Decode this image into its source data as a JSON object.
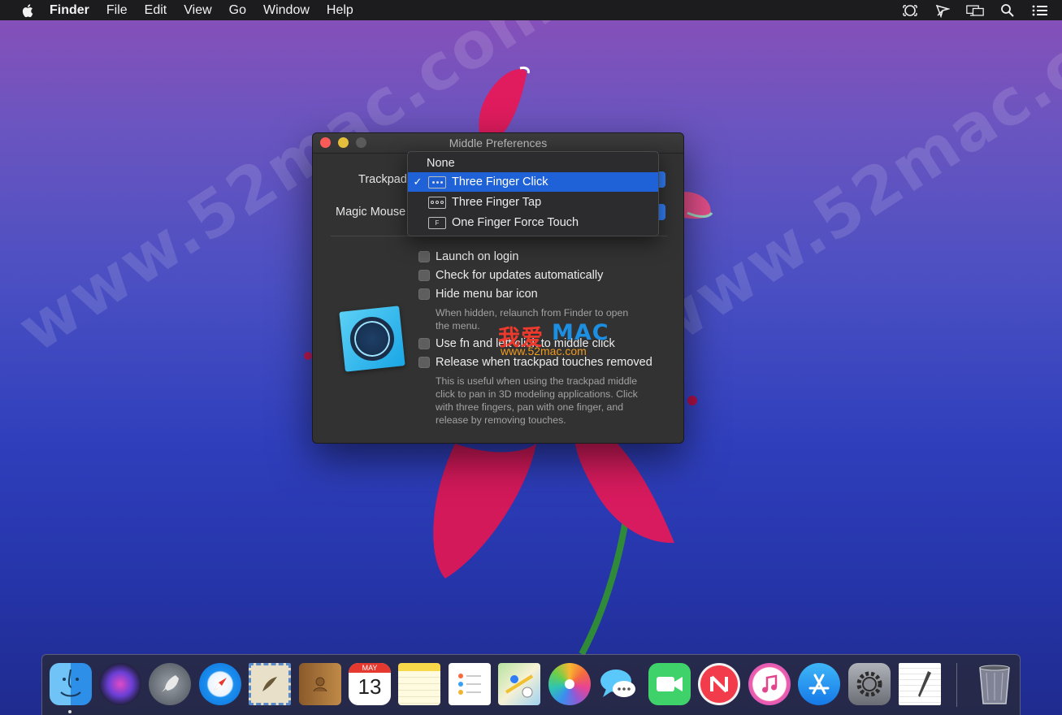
{
  "menubar": {
    "app_name": "Finder",
    "menus": [
      "File",
      "Edit",
      "View",
      "Go",
      "Window",
      "Help"
    ],
    "status_icons": [
      "screen-capture-icon",
      "middle-cursor-icon",
      "airplay-display-icon",
      "spotlight-search-icon",
      "notification-center-icon"
    ]
  },
  "desktop": {
    "watermark_text": "www.52mac.com"
  },
  "window": {
    "title": "Middle Preferences",
    "trackpad_label": "Trackpad",
    "magic_mouse_label": "Magic Mouse",
    "options": [
      {
        "label": "Launch on login",
        "checked": false
      },
      {
        "label": "Check for updates automatically",
        "checked": false
      },
      {
        "label": "Hide menu bar icon",
        "checked": false
      },
      {
        "label": "Use fn and left click to middle click",
        "checked": false
      },
      {
        "label": "Release when trackpad touches removed",
        "checked": false
      }
    ],
    "hide_icon_hint_line1": "When hidden, relaunch from Finder to open",
    "hide_icon_hint_line2": "the menu.",
    "release_hint_line1": "This is useful when using the trackpad middle",
    "release_hint_line2": "click to pan in 3D modeling applications. Click",
    "release_hint_line3": "with three fingers, pan with one finger, and",
    "release_hint_line4": "release by removing touches.",
    "overlay_watermark_cn": "我爱",
    "overlay_watermark_mac": "MAC",
    "overlay_watermark_url": "www.52mac.com"
  },
  "popup_menu": {
    "items": [
      {
        "label": "None",
        "selected": false,
        "icon": ""
      },
      {
        "label": "Three Finger Click",
        "selected": true,
        "icon": "three-finger-click-icon"
      },
      {
        "label": "Three Finger Tap",
        "selected": false,
        "icon": "three-finger-tap-icon"
      },
      {
        "label": "One Finger Force Touch",
        "selected": false,
        "icon": "force-touch-icon"
      }
    ],
    "check_glyph": "✓",
    "force_touch_glyph": "F"
  },
  "dock": {
    "apps": [
      "Finder",
      "Siri",
      "Launchpad",
      "Safari",
      "Mail",
      "Contacts",
      "Calendar",
      "Notes",
      "Reminders",
      "Maps",
      "Photos",
      "Messages",
      "FaceTime",
      "News",
      "iTunes",
      "App Store",
      "System Preferences",
      "TextEdit",
      "Trash"
    ],
    "calendar_month": "MAY",
    "calendar_day": "13"
  },
  "colors": {
    "accent": "#1f62d8",
    "window_bg": "#323232",
    "menubar_bg": "#1c1c1e"
  }
}
